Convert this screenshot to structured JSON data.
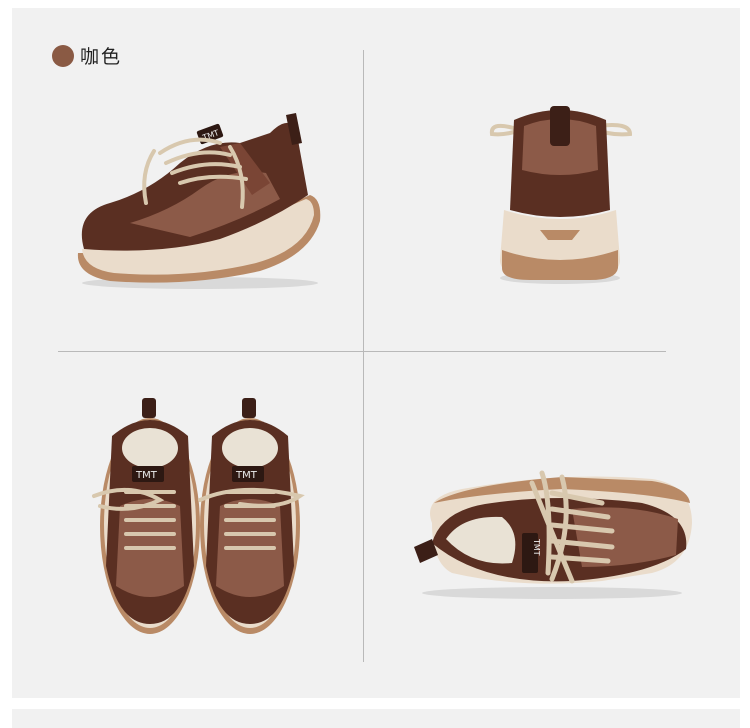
{
  "color_option": {
    "label": "咖色",
    "swatch_color": "#8a5a44"
  },
  "shoe_badge": "TMT",
  "colors": {
    "panel": "#f1f1f1",
    "divider": "#b9b9b9",
    "upper_dark": "#5a2f22",
    "upper_mid": "#7a4535",
    "leather": "#8c5a48",
    "sole_cream": "#eadccb",
    "sole_tan": "#b98a66",
    "lace": "#d8c8ae",
    "lining": "#e9e2d5"
  },
  "views": [
    {
      "name": "side-view"
    },
    {
      "name": "rear-view"
    },
    {
      "name": "top-view-pair"
    },
    {
      "name": "inner-side-view"
    }
  ]
}
